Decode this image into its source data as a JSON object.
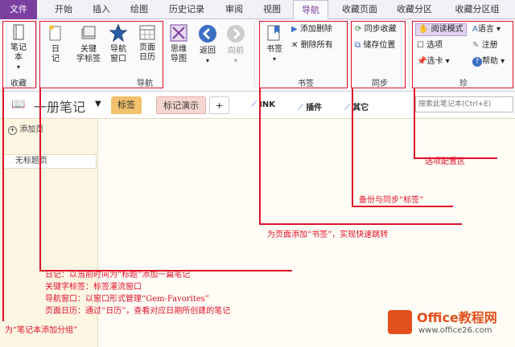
{
  "tabs": [
    "文件",
    "开始",
    "插入",
    "绘图",
    "历史记录",
    "审阅",
    "视图",
    "导航",
    "收藏页面",
    "收藏分区",
    "收藏分区组"
  ],
  "ribbon": {
    "notebook_label": "笔记\n本",
    "diary_label": "日\n记",
    "keyword_label": "关键\n字标签",
    "navwin_label": "导航\n窗口",
    "calendar_label": "页面\n日历",
    "mindmap_label": "思维\n导图",
    "back_label": "返回",
    "forward_label": "向前",
    "bookmark_label": "书签",
    "add_delete": "添加删除",
    "delete_all": "删除所有",
    "sync_fav": "同步收藏",
    "save_pos": "储存位置",
    "read_mode": "阅读模式",
    "language": "语言",
    "options": "选项",
    "register": "注册",
    "tab_card": "选卡",
    "help": "帮助",
    "groups": {
      "fav": "收藏",
      "nav": "导航",
      "bookmark": "书签",
      "sync": "同步",
      "zhen": "珍"
    }
  },
  "notebook": {
    "name": "一册笔记",
    "tabs": [
      "标签",
      "标记演示",
      "+"
    ],
    "quick": [
      "INK",
      "插件",
      "其它"
    ],
    "search_placeholder": "搜索此笔记本(Ctrl+E)",
    "add_page": "添加页",
    "untitled": "无标题页"
  },
  "annotations": {
    "options": "选项配置区",
    "sync": "备份与同步“标签”",
    "bookmark": "为页面添加“书签”，实现快速跳转",
    "diary": "日记：以当前时间为“标题”添加一篇笔记",
    "keyword": "关键字标签：标签灌流窗口",
    "navwin": "导航窗口：以窗口形式管理“Gem-Favorites”",
    "calendar": "页面日历：通过“日历”，查看对应日期所创建的笔记",
    "section": "为“笔记本添加分组”"
  },
  "watermark": {
    "brand": "Office教程网",
    "url": "www.office26.com"
  },
  "colors": {
    "accent": "#7b3fa0",
    "annotation": "#e0102a",
    "tab_highlight": "#f2c16b"
  }
}
